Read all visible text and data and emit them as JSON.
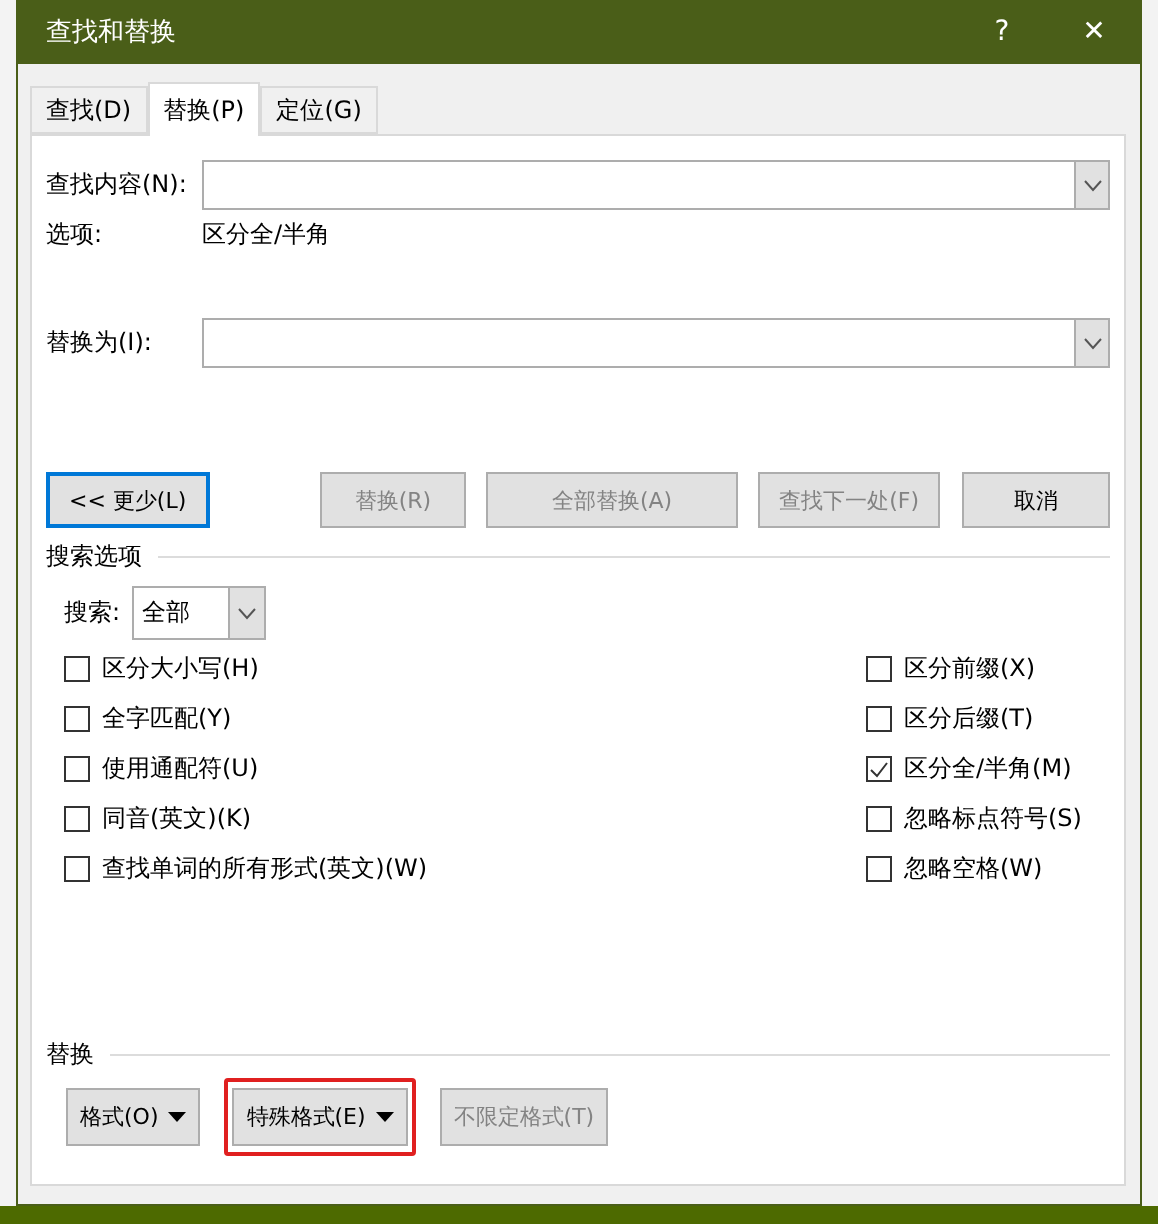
{
  "window": {
    "title": "查找和替换",
    "help": "?",
    "close": "✕"
  },
  "tabs": [
    {
      "label": "查找(D)",
      "selected": false
    },
    {
      "label": "替换(P)",
      "selected": true
    },
    {
      "label": "定位(G)",
      "selected": false
    }
  ],
  "find": {
    "label": "查找内容(N):"
  },
  "options": {
    "label": "选项:",
    "value": "区分全/半角"
  },
  "replace": {
    "label": "替换为(I):"
  },
  "buttons": [
    {
      "label": "<< 更少(L)",
      "disabled": false,
      "focused": true
    },
    {
      "label": "替换(R)",
      "disabled": true,
      "focused": false
    },
    {
      "label": "全部替换(A)",
      "disabled": true,
      "focused": false
    },
    {
      "label": "查找下一处(F)",
      "disabled": true,
      "focused": false
    },
    {
      "label": "取消",
      "disabled": false,
      "focused": false
    }
  ],
  "search_options": {
    "title": "搜索选项",
    "search_label": "搜索:",
    "search_value": "全部"
  },
  "left_checks": [
    {
      "label": "区分大小写(H)",
      "checked": false
    },
    {
      "label": "全字匹配(Y)",
      "checked": false
    },
    {
      "label": "使用通配符(U)",
      "checked": false
    },
    {
      "label": "同音(英文)(K)",
      "checked": false
    },
    {
      "label": "查找单词的所有形式(英文)(W)",
      "checked": false
    }
  ],
  "right_checks": [
    {
      "label": "区分前缀(X)",
      "checked": false
    },
    {
      "label": "区分后缀(T)",
      "checked": false
    },
    {
      "label": "区分全/半角(M)",
      "checked": true
    },
    {
      "label": "忽略标点符号(S)",
      "checked": false
    },
    {
      "label": "忽略空格(W)",
      "checked": false
    }
  ],
  "replace_section": {
    "title": "替换"
  },
  "format_buttons": [
    {
      "label": "格式(O)",
      "dropdown": true,
      "disabled": false,
      "highlighted": false
    },
    {
      "label": "特殊格式(E)",
      "dropdown": true,
      "disabled": false,
      "highlighted": true
    },
    {
      "label": "不限定格式(T)",
      "dropdown": false,
      "disabled": true,
      "highlighted": false
    }
  ]
}
